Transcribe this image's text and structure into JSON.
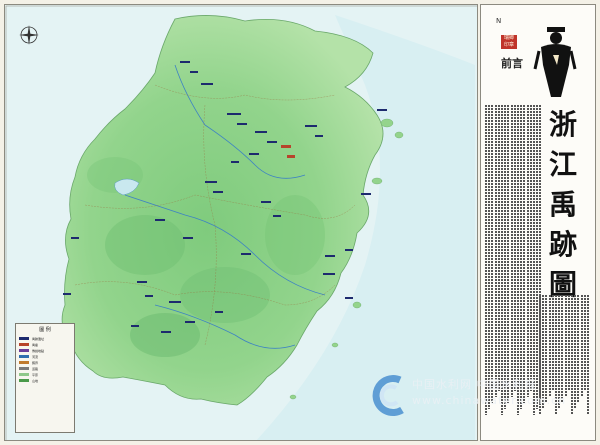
{
  "map": {
    "title": "浙江禹跡圖",
    "preface_label": "前言",
    "seal_text": "瑞卿印章",
    "north_mark": "N",
    "legend_title": "圖 例",
    "legend_items": [
      {
        "color": "#1d2a6e",
        "label": "禹跡遺址"
      },
      {
        "color": "#b7442c",
        "label": "禹廟"
      },
      {
        "color": "#6a3d9a",
        "label": "傳說地點"
      },
      {
        "color": "#2f6fb0",
        "label": "河流"
      },
      {
        "color": "#c07a2c",
        "label": "縣界"
      },
      {
        "color": "#7a7a7a",
        "label": "道路"
      },
      {
        "color": "#8fc88a",
        "label": "平原"
      },
      {
        "color": "#4a9a4a",
        "label": "山地"
      }
    ],
    "colors": {
      "land": "#8fd28b",
      "land_dark": "#5fb46a",
      "sea": "#dff1f2",
      "site": "#1d2a6e",
      "temple": "#b7442c",
      "watermark": "#2a6fb0"
    },
    "icons": [
      "compass-rose-icon",
      "yu-figure-icon",
      "watermark-logo-icon"
    ]
  },
  "watermark": {
    "text_cn": "中国水利网  中国水利报",
    "url": "www.chinawater.com.cn"
  }
}
